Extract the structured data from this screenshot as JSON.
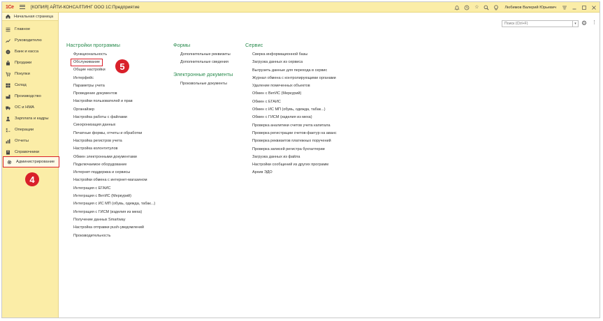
{
  "titlebar": {
    "logo": "1Сe",
    "title": "[КОПИЯ] АЙТИ-КОНСАЛТИНГ ООО 1С:Предприятие",
    "user": "Любимов Валерий Юрьевич"
  },
  "sidebar": {
    "home": "Начальная страница",
    "items": [
      {
        "label": "Главное",
        "icon": "menu-lines-icon"
      },
      {
        "label": "Руководителю",
        "icon": "trend-chart-icon"
      },
      {
        "label": "Банк и касса",
        "icon": "coin-icon"
      },
      {
        "label": "Продажи",
        "icon": "shopping-bag-icon"
      },
      {
        "label": "Покупки",
        "icon": "cart-icon"
      },
      {
        "label": "Склад",
        "icon": "warehouse-icon"
      },
      {
        "label": "Производство",
        "icon": "factory-icon"
      },
      {
        "label": "ОС и НМА",
        "icon": "truck-icon"
      },
      {
        "label": "Зарплата и кадры",
        "icon": "person-icon"
      },
      {
        "label": "Операции",
        "icon": "operations-icon"
      },
      {
        "label": "Отчеты",
        "icon": "bar-chart-icon"
      },
      {
        "label": "Справочники",
        "icon": "book-icon"
      },
      {
        "label": "Администрирование",
        "icon": "gear-icon"
      }
    ]
  },
  "badges": {
    "step4": "4",
    "step5": "5"
  },
  "search": {
    "placeholder": "Поиск (Ctrl+F)"
  },
  "columns": {
    "settings": {
      "title": "Настройки программы",
      "links": [
        "Функциональность",
        "Обслуживание",
        "Общие настройки",
        "Интерфейс",
        "Параметры учета",
        "Проведение документов",
        "Настройки пользователей и прав",
        "Органайзер",
        "Настройка работы с файлами",
        "Синхронизация данных",
        "Печатные формы, отчеты и обработки",
        "Настройка регистров учета",
        "Настройка колонтитулов",
        "Обмен электронными документами",
        "Подключаемое оборудование",
        "Интернет-поддержка и сервисы",
        "Настройки обмена с интернет-магазином",
        "Интеграция с ЕГАИС",
        "Интеграция с ВетИС (Меркурий)",
        "Интеграция с ИС МП (обувь, одежда, табак...)",
        "Интеграция с ГИСМ (изделия из меха)",
        "Получение данных Smartway",
        "Настройка отправки push-уведомлений",
        "Производительность"
      ]
    },
    "forms": {
      "title": "Формы",
      "links": [
        "Дополнительные реквизиты",
        "Дополнительные сведения"
      ]
    },
    "edocs": {
      "title": "Электронные документы",
      "links": [
        "Произвольные документы"
      ]
    },
    "service": {
      "title": "Сервис",
      "links": [
        "Сверка информационной базы",
        "Загрузка данных из сервиса",
        "Выгрузить данные для перехода в сервис",
        "Журнал обмена с контролирующими органами",
        "Удаление помеченных объектов",
        "Обмен с ВетИС (Меркурий)",
        "Обмен с ЕГАИС",
        "Обмен с ИС МП (обувь, одежда, табак...)",
        "Обмен с ГИСМ (изделия из меха)",
        "Проверка аналитики счетов учета капитала",
        "Проверка регистрации счетов-фактур на аванс",
        "Проверка реквизитов платежных поручений",
        "Проверка записей регистра бухгалтерии",
        "Загрузка данных из файла",
        "Настройки сообщений из других программ",
        "Архив ЭДО"
      ]
    }
  },
  "colors": {
    "accent": "#d9202a",
    "sectionTitle": "#2b8c4f",
    "panel": "#fbeda7"
  }
}
